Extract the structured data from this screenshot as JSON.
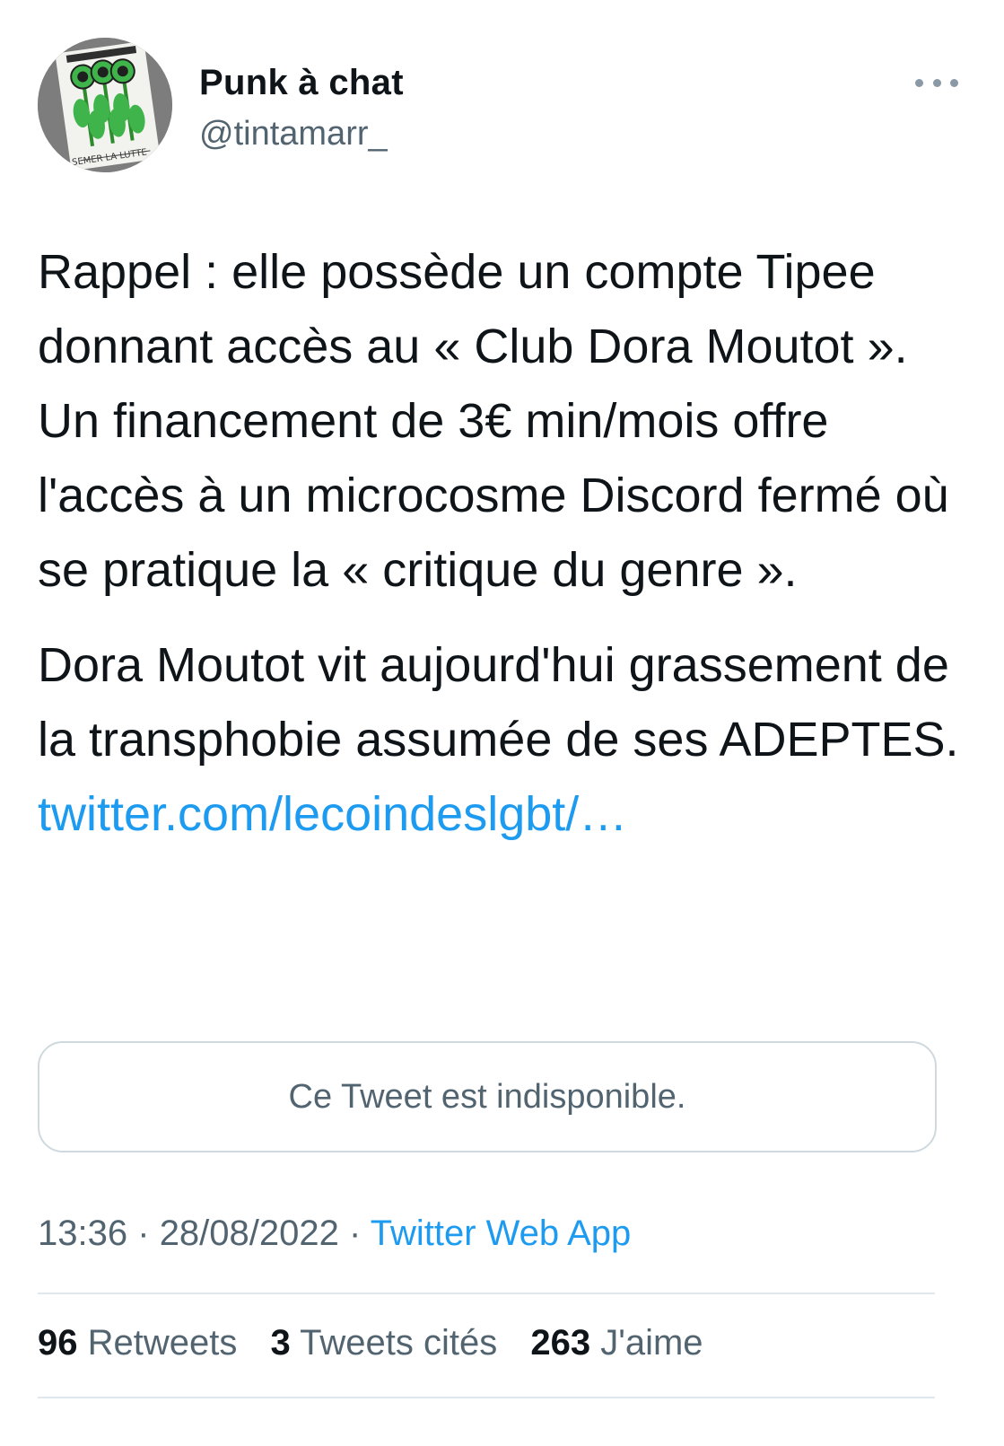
{
  "author": {
    "name": "Punk à chat",
    "handle": "@tintamarr_",
    "avatar_icon": "sunflowers-artwork-avatar",
    "avatar_caption": "SEMER LA LUTTE"
  },
  "tweet": {
    "paragraph1": "Rappel : elle possède un compte Tipee donnant accès au « Club Dora Moutot ». Un financement de 3€ min/mois offre l'accès à un microcosme Discord fermé où se pratique la « critique du genre ».",
    "paragraph2": "Dora Moutot vit aujourd'hui grassement de la transphobie assumée de ses ADEPTES.",
    "link": "twitter.com/lecoindeslgbt/…"
  },
  "quoted_tweet": {
    "unavailable_text": "Ce Tweet est indisponible."
  },
  "meta": {
    "time": "13:36",
    "date": "28/08/2022",
    "separator": "·",
    "source": "Twitter Web App"
  },
  "stats": {
    "retweets_count": "96",
    "retweets_label": "Retweets",
    "quotes_count": "3",
    "quotes_label": "Tweets cités",
    "likes_count": "263",
    "likes_label": "J'aime"
  },
  "colors": {
    "link": "#1d9bf0",
    "secondary_text": "#536471",
    "primary_text": "#0f1419",
    "border": "#cfd9de"
  }
}
